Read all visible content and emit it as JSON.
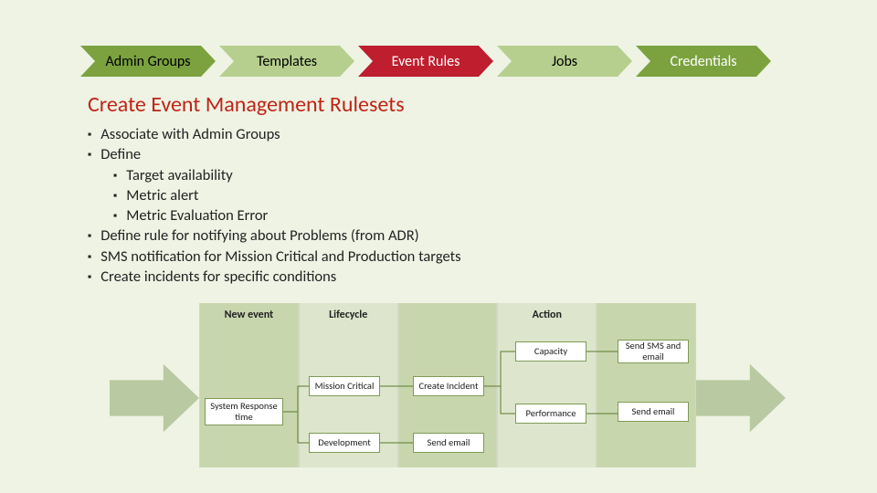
{
  "breadcrumb": {
    "items": [
      {
        "label": "Admin Groups",
        "fill": "#7ba23f",
        "text": "#000000"
      },
      {
        "label": "Templates",
        "fill": "#b6cf8e",
        "text": "#000000"
      },
      {
        "label": "Event Rules",
        "fill": "#be1e2d",
        "text": "#ffffff"
      },
      {
        "label": "Jobs",
        "fill": "#b6cf8e",
        "text": "#000000"
      },
      {
        "label": "Credentials",
        "fill": "#7ba23f",
        "text": "#ffffff"
      }
    ]
  },
  "heading": "Create Event Management Rulesets",
  "bullets": {
    "l1": [
      "Associate with Admin Groups",
      "Define",
      "Define rule for notifying about Problems (from ADR)",
      "SMS notification for Mission Critical and Production targets",
      "Create incidents for specific conditions"
    ],
    "l2_under_define": [
      "Target availability",
      "Metric alert",
      "Metric Evaluation Error"
    ]
  },
  "diagram": {
    "columns": [
      "New event",
      "Lifecycle",
      "",
      "Action",
      ""
    ],
    "nodes": {
      "system_response": "System Response time",
      "mission_critical": "Mission Critical",
      "development": "Development",
      "create_incident": "Create Incident",
      "send_email_dev": "Send email",
      "capacity": "Capacity",
      "performance": "Performance",
      "send_sms_email": "Send SMS and email",
      "send_email_perf": "Send email"
    }
  },
  "colors": {
    "bg": "#eef3e4",
    "heading": "#c02418",
    "arrow": "#b9c9a1",
    "col_dark": "#c8d6ad",
    "col_light": "#dde6cc"
  }
}
